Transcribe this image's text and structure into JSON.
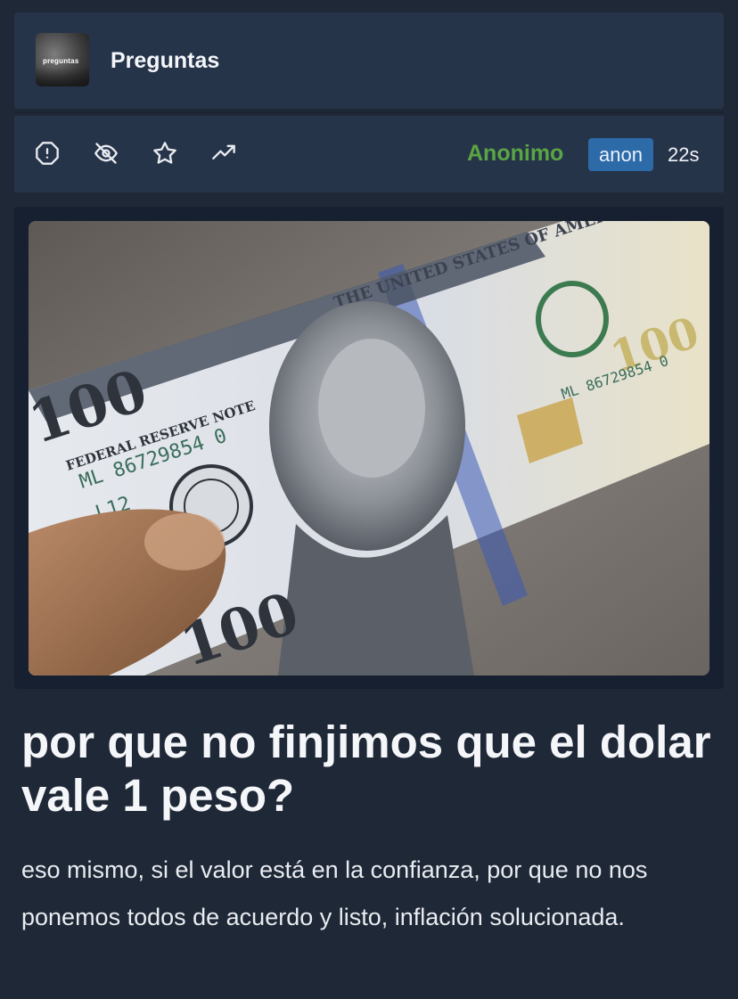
{
  "community": {
    "name": "Preguntas",
    "avatar_text": "preguntas"
  },
  "post_meta": {
    "author": "Anonimo",
    "badge": "anon",
    "time": "22s"
  },
  "actions": [
    {
      "icon": "report-icon"
    },
    {
      "icon": "hide-icon"
    },
    {
      "icon": "star-icon"
    },
    {
      "icon": "trending-icon"
    }
  ],
  "colors": {
    "background": "#1f2836",
    "card": "#26344a",
    "author": "#5aa543",
    "badge": "#2d6aa8"
  },
  "image": {
    "bill_value": "100",
    "note_text": "FEDERAL RESERVE NOTE",
    "serial": "ML 86729854 0",
    "serial_short": "ML 86729854 0",
    "plate": "L12",
    "headline": "THE UNITED STATES OF AMERICA",
    "small_serial": "ML 86729854 0"
  },
  "post": {
    "title": "por que no finjimos que el dolar vale 1 peso?",
    "body": "eso mismo, si el valor está en la confianza, por que no nos ponemos todos de acuerdo y listo, inflación solucionada."
  }
}
